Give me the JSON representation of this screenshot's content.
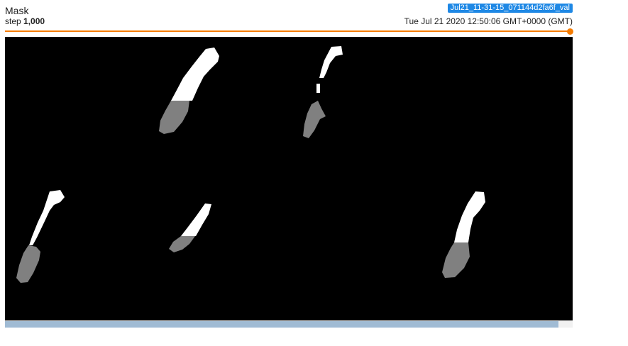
{
  "card": {
    "title": "Mask",
    "step_prefix": "step",
    "step_value": "1,000",
    "run_name": "Jul21_11-31-15_071144d2fa6f_val",
    "timestamp": "Tue Jul 21 2020 12:50:06 GMT+0000 (GMT)"
  },
  "colors": {
    "accent": "#f57c00",
    "badge": "#1e88e5",
    "mask_foreground": "#ffffff",
    "mask_secondary": "#808080",
    "background": "#000000"
  },
  "slider": {
    "progress": 1.0
  }
}
